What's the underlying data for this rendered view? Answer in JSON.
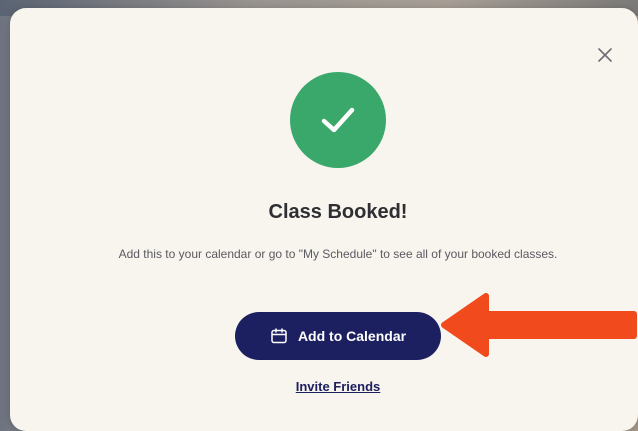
{
  "modal": {
    "close_icon": "close-icon",
    "status_icon": "checkmark-icon",
    "title": "Class Booked!",
    "description": "Add this to your calendar or go to \"My Schedule\" to see all of your booked classes.",
    "primary_button": {
      "label": "Add to Calendar",
      "icon": "calendar-icon"
    },
    "secondary_link": "Invite Friends"
  },
  "colors": {
    "success": "#3aa86a",
    "primary": "#1d2060",
    "annotation_arrow": "#f04a1d",
    "modal_bg": "#f8f4ee"
  }
}
